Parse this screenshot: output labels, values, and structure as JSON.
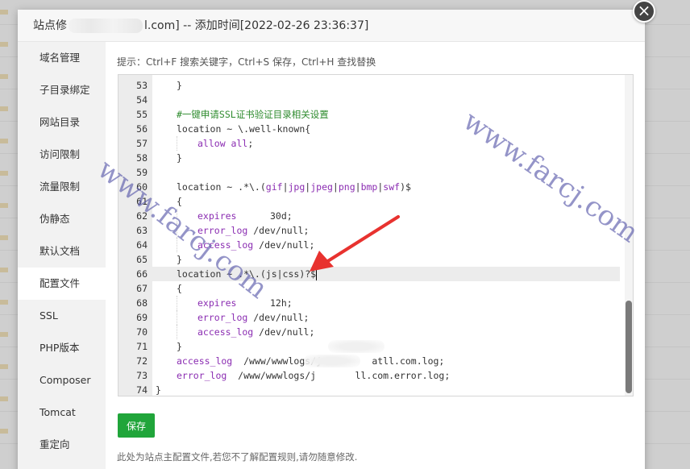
{
  "window": {
    "title_prefix": "站点修",
    "title_suffix": "l.com] -- 添加时间[2022-02-26 23:36:37]",
    "close_glyph": "×"
  },
  "sidebar": {
    "items": [
      {
        "label": "域名管理"
      },
      {
        "label": "子目录绑定"
      },
      {
        "label": "网站目录"
      },
      {
        "label": "访问限制"
      },
      {
        "label": "流量限制"
      },
      {
        "label": "伪静态"
      },
      {
        "label": "默认文档"
      },
      {
        "label": "配置文件"
      },
      {
        "label": "SSL"
      },
      {
        "label": "PHP版本"
      },
      {
        "label": "Composer"
      },
      {
        "label": "Tomcat"
      },
      {
        "label": "重定向"
      }
    ],
    "active_index": 7
  },
  "editor": {
    "hint": "提示：Ctrl+F 搜索关键字，Ctrl+S 保存，Ctrl+H 查找替换",
    "lines": [
      {
        "n": "53",
        "indent": 1,
        "parts": [
          {
            "t": "}"
          }
        ]
      },
      {
        "n": "54",
        "indent": 0,
        "parts": []
      },
      {
        "n": "55",
        "indent": 1,
        "parts": [
          {
            "t": "#一键申请SSL证书验证目录相关设置",
            "c": "cm"
          }
        ]
      },
      {
        "n": "56",
        "indent": 1,
        "parts": [
          {
            "t": "location ~ \\.well-known{"
          }
        ]
      },
      {
        "n": "57",
        "indent": 2,
        "parts": [
          {
            "t": "allow all",
            "c": "kw"
          },
          {
            "t": ";"
          }
        ]
      },
      {
        "n": "58",
        "indent": 1,
        "parts": [
          {
            "t": "}"
          }
        ]
      },
      {
        "n": "59",
        "indent": 0,
        "parts": []
      },
      {
        "n": "60",
        "indent": 1,
        "parts": [
          {
            "t": "location ~ .*\\.("
          },
          {
            "t": "gif",
            "c": "kw"
          },
          {
            "t": "|"
          },
          {
            "t": "jpg",
            "c": "kw"
          },
          {
            "t": "|"
          },
          {
            "t": "jpeg",
            "c": "kw"
          },
          {
            "t": "|"
          },
          {
            "t": "png",
            "c": "kw"
          },
          {
            "t": "|"
          },
          {
            "t": "bmp",
            "c": "kw"
          },
          {
            "t": "|"
          },
          {
            "t": "swf",
            "c": "kw"
          },
          {
            "t": ")$"
          }
        ]
      },
      {
        "n": "61",
        "indent": 1,
        "parts": [
          {
            "t": "{"
          }
        ]
      },
      {
        "n": "62",
        "indent": 2,
        "parts": [
          {
            "t": "expires",
            "c": "kw"
          },
          {
            "t": "      30d;"
          }
        ]
      },
      {
        "n": "63",
        "indent": 2,
        "parts": [
          {
            "t": "error_log",
            "c": "kw"
          },
          {
            "t": " /dev/null;"
          }
        ]
      },
      {
        "n": "64",
        "indent": 2,
        "parts": [
          {
            "t": "access_log",
            "c": "kw"
          },
          {
            "t": " /dev/null;"
          }
        ]
      },
      {
        "n": "65",
        "indent": 1,
        "parts": [
          {
            "t": "}"
          }
        ]
      },
      {
        "n": "66",
        "indent": 1,
        "current": true,
        "parts": [
          {
            "t": "location ~ .*\\.(js|css)?$"
          }
        ]
      },
      {
        "n": "67",
        "indent": 1,
        "parts": [
          {
            "t": "{"
          }
        ]
      },
      {
        "n": "68",
        "indent": 2,
        "parts": [
          {
            "t": "expires",
            "c": "kw"
          },
          {
            "t": "      12h;"
          }
        ]
      },
      {
        "n": "69",
        "indent": 2,
        "parts": [
          {
            "t": "error_log",
            "c": "kw"
          },
          {
            "t": " /dev/null;"
          }
        ]
      },
      {
        "n": "70",
        "indent": 2,
        "parts": [
          {
            "t": "access_log",
            "c": "kw"
          },
          {
            "t": " /dev/null;"
          }
        ]
      },
      {
        "n": "71",
        "indent": 1,
        "parts": [
          {
            "t": "}"
          }
        ]
      },
      {
        "n": "72",
        "indent": 1,
        "parts": [
          {
            "t": "access_log",
            "c": "kw"
          },
          {
            "t": "  /www/wwwlogs/j         atll.com.log;"
          }
        ]
      },
      {
        "n": "73",
        "indent": 1,
        "parts": [
          {
            "t": "error_log",
            "c": "kw"
          },
          {
            "t": "  /www/wwwlogs/j       ll.com.error.log;"
          }
        ]
      },
      {
        "n": "74",
        "indent": 0,
        "parts": [
          {
            "t": "}"
          }
        ]
      }
    ]
  },
  "actions": {
    "save_label": "保存",
    "footer_note": "此处为站点主配置文件,若您不了解配置规则,请勿随意修改."
  },
  "watermark": {
    "text": "www.farcj.com"
  },
  "colors": {
    "accent": "#20a53a",
    "keyword": "#8b2db2",
    "comment": "#2e8b2e",
    "arrow": "#e8322f"
  }
}
